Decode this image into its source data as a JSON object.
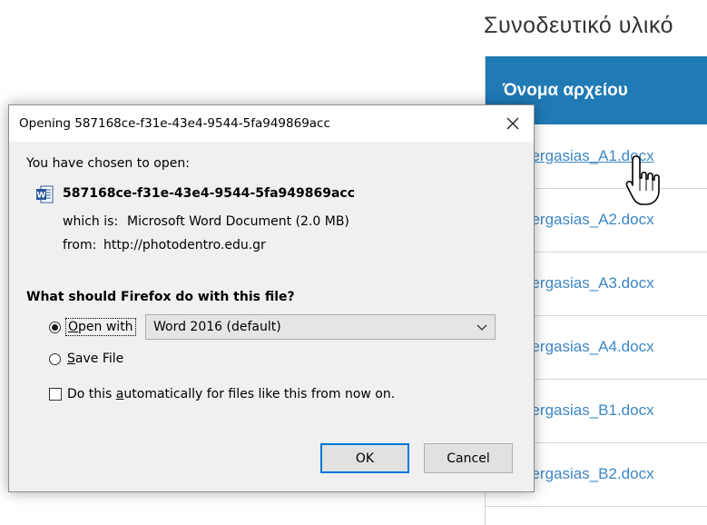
{
  "background_page": {
    "heading": "Συνοδευτικό υλικό",
    "table_header": "Όνομα αρχείου",
    "files": [
      "_ergasias_A1.docx",
      "_ergasias_A2.docx",
      "_ergasias_A3.docx",
      "_ergasias_A4.docx",
      "_ergasias_B1.docx",
      "_ergasias_B2.docx"
    ],
    "colors": {
      "table_header_bg": "#1f7ab6",
      "link": "#3d87c4"
    },
    "cursor_icon": "hand-pointer-icon"
  },
  "dialog": {
    "title": "Opening 587168ce-f31e-43e4-9544-5fa949869acc",
    "close_icon": "close-icon",
    "chosen_text": "You have chosen to open:",
    "file_icon": "word-document-icon",
    "file_name": "587168ce-f31e-43e4-9544-5fa949869acc",
    "which_label": "which is:",
    "which_value": "Microsoft Word Document (2.0 MB)",
    "from_label": "from:",
    "from_value": "http://photodentro.edu.gr",
    "question": "What should Firefox do with this file?",
    "open_with": {
      "prefix_underlined": "O",
      "rest": "pen with",
      "selected": true
    },
    "app_select": {
      "value": "Word 2016 (default)"
    },
    "save_file": {
      "prefix_underlined": "S",
      "rest": "ave File",
      "selected": false
    },
    "auto_checkbox": {
      "before": "Do this ",
      "underlined": "a",
      "after": "utomatically for files like this from now on.",
      "checked": false
    },
    "ok_label": "OK",
    "cancel_label": "Cancel"
  }
}
